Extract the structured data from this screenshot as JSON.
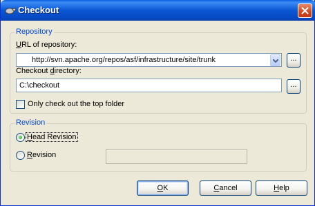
{
  "window": {
    "title": "Checkout",
    "app_icon": "tortoisesvn-icon",
    "close_icon": "close-icon"
  },
  "repository": {
    "legend": "Repository",
    "url_label": "URL of repository:",
    "url_value": "http://svn.apache.org/repos/asf/infrastructure/site/trunk",
    "checkout_label": "Checkout directory:",
    "checkout_value": "C:\\checkout",
    "browse_label": "...",
    "top_folder_label": "Only check out the top folder",
    "top_folder_checked": false
  },
  "revision": {
    "legend": "Revision",
    "head_label": "Head Revision",
    "head_selected": true,
    "revision_label": "Revision",
    "revision_value": ""
  },
  "buttons": {
    "ok": "OK",
    "cancel": "Cancel",
    "help": "Help"
  },
  "colors": {
    "title_bar": "#0a57d4",
    "group_legend": "#0046d5",
    "dialog_bg": "#ece9d8"
  }
}
